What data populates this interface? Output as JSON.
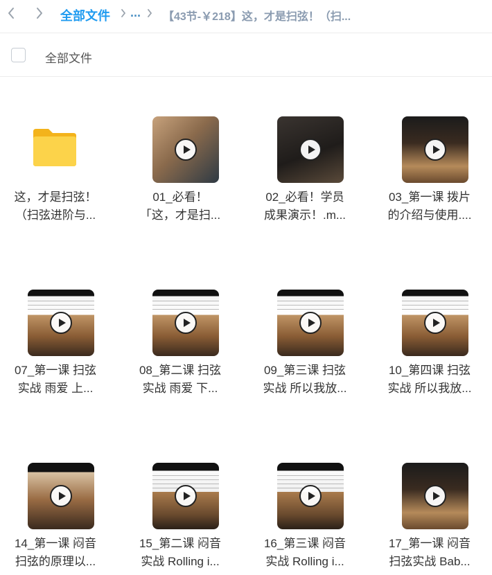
{
  "nav": {
    "breadcrumb_root": "全部文件",
    "breadcrumb_ellipsis": "...",
    "breadcrumb_current": "【43节-￥218】这，才是扫弦！（扫..."
  },
  "toolbar": {
    "select_all_label": "全部文件"
  },
  "colors": {
    "accent": "#1f9bf0",
    "folder": "#f9c328"
  },
  "items": [
    {
      "type": "folder",
      "line1": "这，才是扫弦！",
      "line2": "（扫弦进阶与..."
    },
    {
      "type": "video",
      "line1": "01_必看！",
      "line2": "「这，才是扫..."
    },
    {
      "type": "video",
      "line1": "02_必看！学员",
      "line2": "成果演示！.m..."
    },
    {
      "type": "video",
      "line1": "03_第一课 拨片",
      "line2": "的介绍与使用...."
    },
    {
      "type": "video",
      "line1": "07_第一课 扫弦",
      "line2": "实战 雨爱 上..."
    },
    {
      "type": "video",
      "line1": "08_第二课 扫弦",
      "line2": "实战 雨爱 下..."
    },
    {
      "type": "video",
      "line1": "09_第三课 扫弦",
      "line2": "实战 所以我放..."
    },
    {
      "type": "video",
      "line1": "10_第四课 扫弦",
      "line2": "实战 所以我放..."
    },
    {
      "type": "video",
      "line1": "14_第一课 闷音",
      "line2": "扫弦的原理以..."
    },
    {
      "type": "video",
      "line1": "15_第二课 闷音",
      "line2": "实战 Rolling i..."
    },
    {
      "type": "video",
      "line1": "16_第三课 闷音",
      "line2": "实战 Rolling i..."
    },
    {
      "type": "video",
      "line1": "17_第一课 闷音",
      "line2": "扫弦实战 Bab..."
    }
  ]
}
